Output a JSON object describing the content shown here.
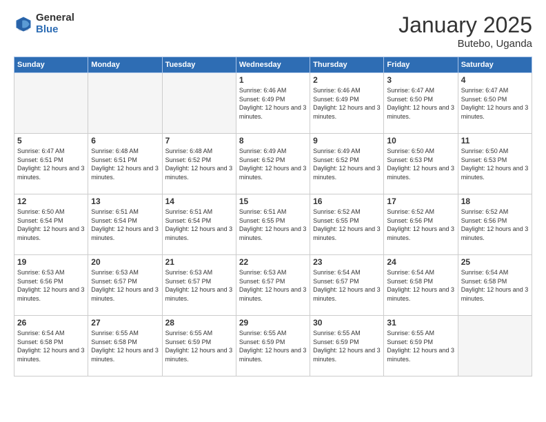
{
  "logo": {
    "general": "General",
    "blue": "Blue"
  },
  "title": "January 2025",
  "subtitle": "Butebo, Uganda",
  "days_header": [
    "Sunday",
    "Monday",
    "Tuesday",
    "Wednesday",
    "Thursday",
    "Friday",
    "Saturday"
  ],
  "weeks": [
    [
      {
        "day": "",
        "info": ""
      },
      {
        "day": "",
        "info": ""
      },
      {
        "day": "",
        "info": ""
      },
      {
        "day": "1",
        "info": "Sunrise: 6:46 AM\nSunset: 6:49 PM\nDaylight: 12 hours\nand 3 minutes."
      },
      {
        "day": "2",
        "info": "Sunrise: 6:46 AM\nSunset: 6:49 PM\nDaylight: 12 hours\nand 3 minutes."
      },
      {
        "day": "3",
        "info": "Sunrise: 6:47 AM\nSunset: 6:50 PM\nDaylight: 12 hours\nand 3 minutes."
      },
      {
        "day": "4",
        "info": "Sunrise: 6:47 AM\nSunset: 6:50 PM\nDaylight: 12 hours\nand 3 minutes."
      }
    ],
    [
      {
        "day": "5",
        "info": "Sunrise: 6:47 AM\nSunset: 6:51 PM\nDaylight: 12 hours\nand 3 minutes."
      },
      {
        "day": "6",
        "info": "Sunrise: 6:48 AM\nSunset: 6:51 PM\nDaylight: 12 hours\nand 3 minutes."
      },
      {
        "day": "7",
        "info": "Sunrise: 6:48 AM\nSunset: 6:52 PM\nDaylight: 12 hours\nand 3 minutes."
      },
      {
        "day": "8",
        "info": "Sunrise: 6:49 AM\nSunset: 6:52 PM\nDaylight: 12 hours\nand 3 minutes."
      },
      {
        "day": "9",
        "info": "Sunrise: 6:49 AM\nSunset: 6:52 PM\nDaylight: 12 hours\nand 3 minutes."
      },
      {
        "day": "10",
        "info": "Sunrise: 6:50 AM\nSunset: 6:53 PM\nDaylight: 12 hours\nand 3 minutes."
      },
      {
        "day": "11",
        "info": "Sunrise: 6:50 AM\nSunset: 6:53 PM\nDaylight: 12 hours\nand 3 minutes."
      }
    ],
    [
      {
        "day": "12",
        "info": "Sunrise: 6:50 AM\nSunset: 6:54 PM\nDaylight: 12 hours\nand 3 minutes."
      },
      {
        "day": "13",
        "info": "Sunrise: 6:51 AM\nSunset: 6:54 PM\nDaylight: 12 hours\nand 3 minutes."
      },
      {
        "day": "14",
        "info": "Sunrise: 6:51 AM\nSunset: 6:54 PM\nDaylight: 12 hours\nand 3 minutes."
      },
      {
        "day": "15",
        "info": "Sunrise: 6:51 AM\nSunset: 6:55 PM\nDaylight: 12 hours\nand 3 minutes."
      },
      {
        "day": "16",
        "info": "Sunrise: 6:52 AM\nSunset: 6:55 PM\nDaylight: 12 hours\nand 3 minutes."
      },
      {
        "day": "17",
        "info": "Sunrise: 6:52 AM\nSunset: 6:56 PM\nDaylight: 12 hours\nand 3 minutes."
      },
      {
        "day": "18",
        "info": "Sunrise: 6:52 AM\nSunset: 6:56 PM\nDaylight: 12 hours\nand 3 minutes."
      }
    ],
    [
      {
        "day": "19",
        "info": "Sunrise: 6:53 AM\nSunset: 6:56 PM\nDaylight: 12 hours\nand 3 minutes."
      },
      {
        "day": "20",
        "info": "Sunrise: 6:53 AM\nSunset: 6:57 PM\nDaylight: 12 hours\nand 3 minutes."
      },
      {
        "day": "21",
        "info": "Sunrise: 6:53 AM\nSunset: 6:57 PM\nDaylight: 12 hours\nand 3 minutes."
      },
      {
        "day": "22",
        "info": "Sunrise: 6:53 AM\nSunset: 6:57 PM\nDaylight: 12 hours\nand 3 minutes."
      },
      {
        "day": "23",
        "info": "Sunrise: 6:54 AM\nSunset: 6:57 PM\nDaylight: 12 hours\nand 3 minutes."
      },
      {
        "day": "24",
        "info": "Sunrise: 6:54 AM\nSunset: 6:58 PM\nDaylight: 12 hours\nand 3 minutes."
      },
      {
        "day": "25",
        "info": "Sunrise: 6:54 AM\nSunset: 6:58 PM\nDaylight: 12 hours\nand 3 minutes."
      }
    ],
    [
      {
        "day": "26",
        "info": "Sunrise: 6:54 AM\nSunset: 6:58 PM\nDaylight: 12 hours\nand 3 minutes."
      },
      {
        "day": "27",
        "info": "Sunrise: 6:55 AM\nSunset: 6:58 PM\nDaylight: 12 hours\nand 3 minutes."
      },
      {
        "day": "28",
        "info": "Sunrise: 6:55 AM\nSunset: 6:59 PM\nDaylight: 12 hours\nand 3 minutes."
      },
      {
        "day": "29",
        "info": "Sunrise: 6:55 AM\nSunset: 6:59 PM\nDaylight: 12 hours\nand 3 minutes."
      },
      {
        "day": "30",
        "info": "Sunrise: 6:55 AM\nSunset: 6:59 PM\nDaylight: 12 hours\nand 3 minutes."
      },
      {
        "day": "31",
        "info": "Sunrise: 6:55 AM\nSunset: 6:59 PM\nDaylight: 12 hours\nand 3 minutes."
      },
      {
        "day": "",
        "info": ""
      }
    ]
  ]
}
